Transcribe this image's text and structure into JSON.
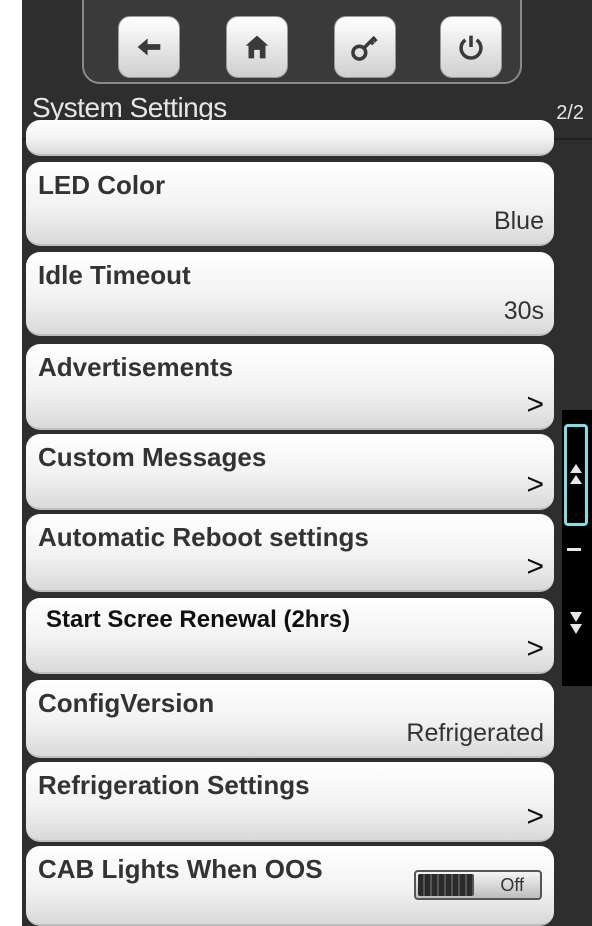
{
  "header": {
    "title": "System Settings",
    "page_indicator": "2/2"
  },
  "toolbar": {
    "buttons": [
      {
        "icon": "back-arrow-icon"
      },
      {
        "icon": "home-icon"
      },
      {
        "icon": "key-icon"
      },
      {
        "icon": "power-icon"
      }
    ]
  },
  "settings": [
    {
      "label": "LED Color",
      "value": "Blue"
    },
    {
      "label": "Idle Timeout",
      "value": "30s"
    },
    {
      "label": "Advertisements",
      "chevron": ">"
    },
    {
      "label": "Custom Messages",
      "chevron": ">"
    },
    {
      "label": "Automatic Reboot settings",
      "chevron": ">"
    },
    {
      "label": "Start Scree Renewal (2hrs)",
      "chevron": ">"
    },
    {
      "label": "ConfigVersion",
      "value": "Refrigerated"
    },
    {
      "label": "Refrigeration Settings",
      "chevron": ">"
    },
    {
      "label": "CAB Lights When OOS",
      "toggle_state": "Off"
    }
  ],
  "colors": {
    "accent": "#7fdde8",
    "panel": "#2e2e2e"
  }
}
